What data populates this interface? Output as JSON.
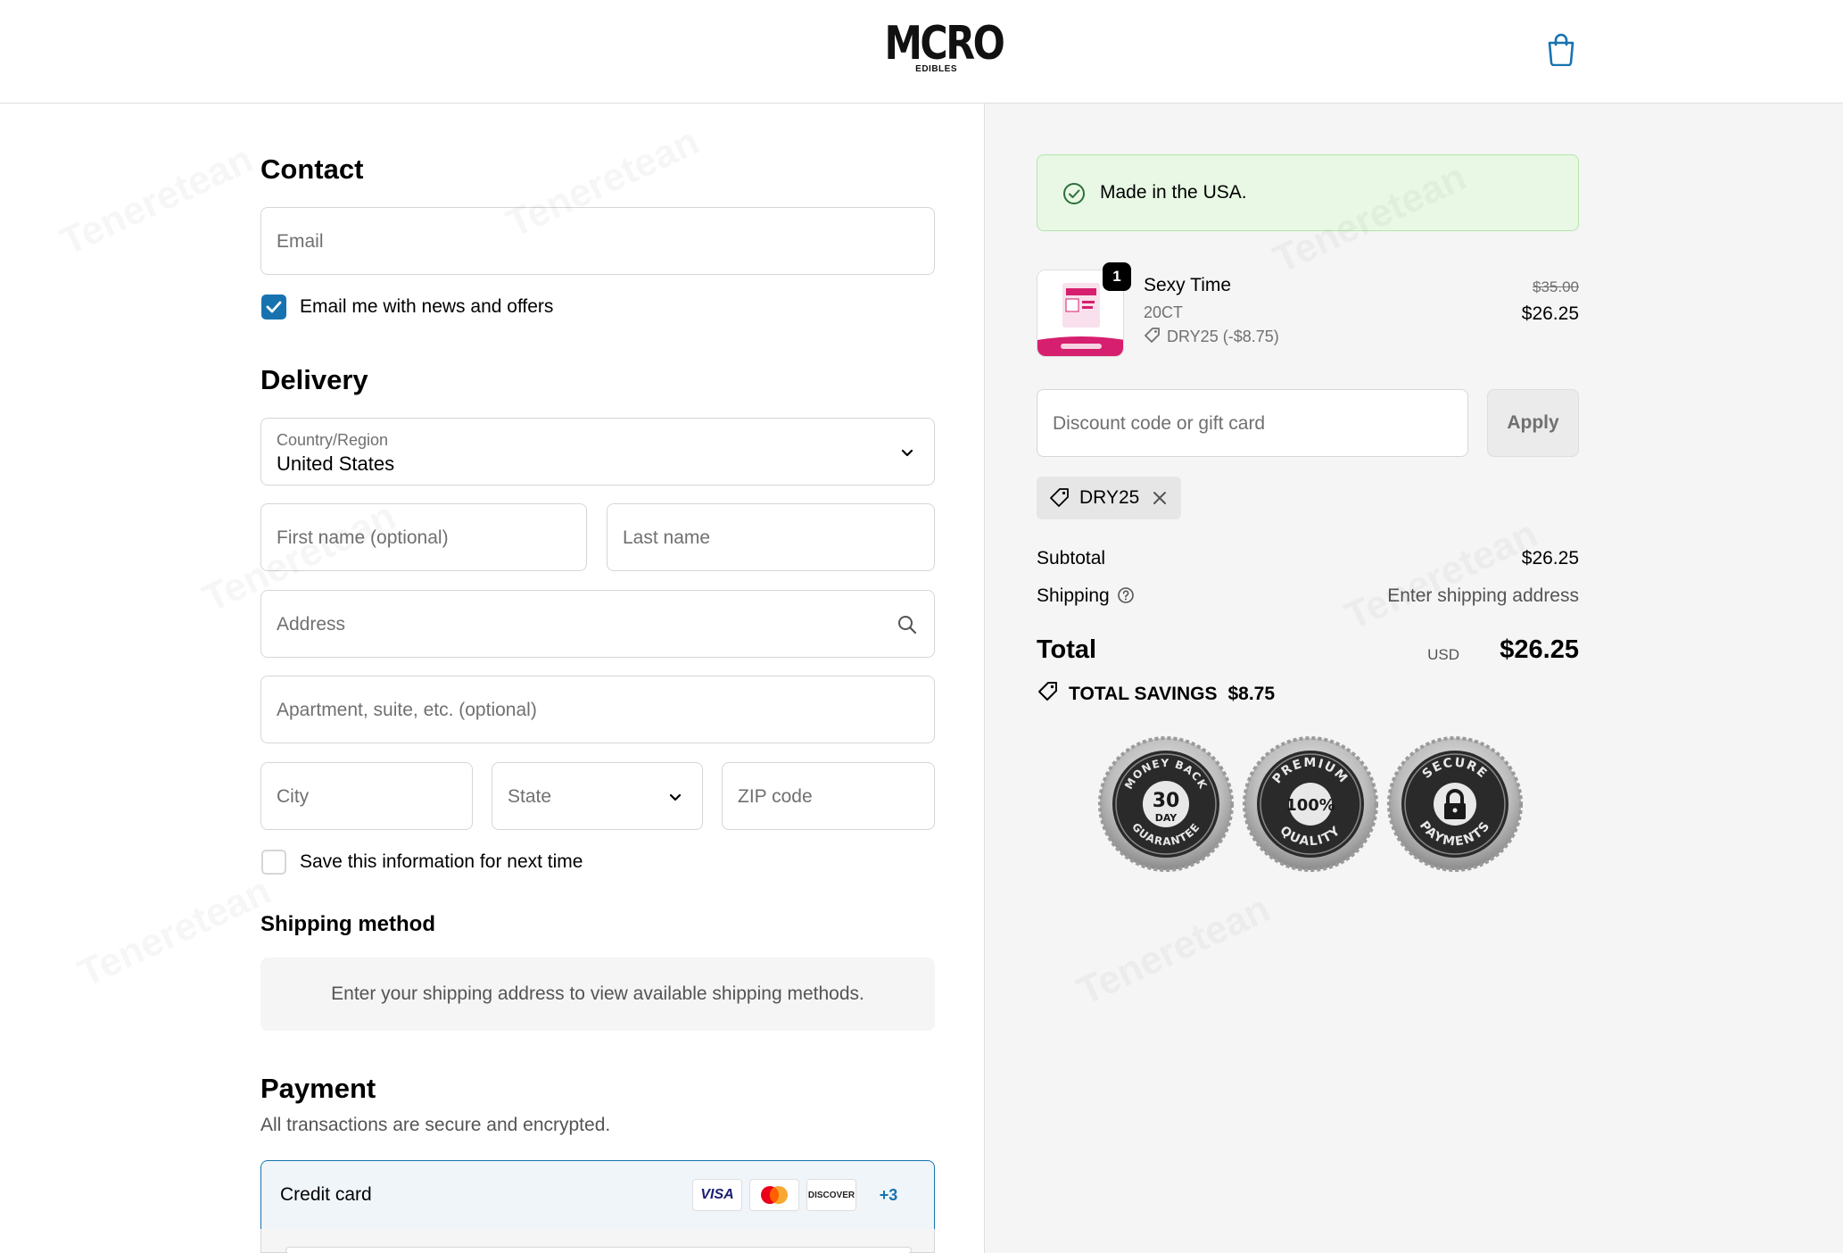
{
  "header": {
    "logo_main": "MCRO",
    "logo_sub": "EDIBLES",
    "cart_icon": "shopping-bag-icon"
  },
  "contact": {
    "title": "Contact",
    "email_placeholder": "Email",
    "news_label": "Email me with news and offers",
    "news_checked": true
  },
  "delivery": {
    "title": "Delivery",
    "country_label": "Country/Region",
    "country_value": "United States",
    "first_name_placeholder": "First name (optional)",
    "last_name_placeholder": "Last name",
    "address_placeholder": "Address",
    "apartment_placeholder": "Apartment, suite, etc. (optional)",
    "city_placeholder": "City",
    "state_placeholder": "State",
    "zip_placeholder": "ZIP code",
    "save_label": "Save this information for next time",
    "save_checked": false
  },
  "shipping_method": {
    "title": "Shipping method",
    "notice": "Enter your shipping address to view available shipping methods."
  },
  "payment": {
    "title": "Payment",
    "description": "All transactions are secure and encrypted.",
    "method_label": "Credit card",
    "card_brands": [
      "VISA",
      "Mastercard",
      "DISCOVER"
    ],
    "more_brands": "+3"
  },
  "summary": {
    "made_in": "Made in the USA.",
    "product": {
      "name": "Sexy Time",
      "variant": "20CT",
      "discount_line": "DRY25 (-$8.75)",
      "quantity": "1",
      "original_price": "$35.00",
      "price": "$26.25"
    },
    "discount_placeholder": "Discount code or gift card",
    "apply_label": "Apply",
    "applied_code": "DRY25",
    "subtotal_label": "Subtotal",
    "subtotal_value": "$26.25",
    "shipping_label": "Shipping",
    "shipping_value": "Enter shipping address",
    "total_label": "Total",
    "currency": "USD",
    "total_value": "$26.25",
    "savings_label": "TOTAL SAVINGS",
    "savings_value": "$8.75",
    "badges": [
      {
        "top": "MONEY BACK",
        "center": "30",
        "center_sub": "DAY",
        "bottom": "GUARANTEE"
      },
      {
        "top": "PREMIUM",
        "center": "100%",
        "center_sub": "",
        "bottom": "QUALITY"
      },
      {
        "top": "SECURE",
        "center": "",
        "center_sub": "",
        "bottom": "PAYMENTS"
      }
    ]
  },
  "colors": {
    "accent": "#1773b0",
    "success_bg": "#e8f8e4",
    "summary_bg": "#f5f5f5"
  },
  "watermark": "Teneretean"
}
